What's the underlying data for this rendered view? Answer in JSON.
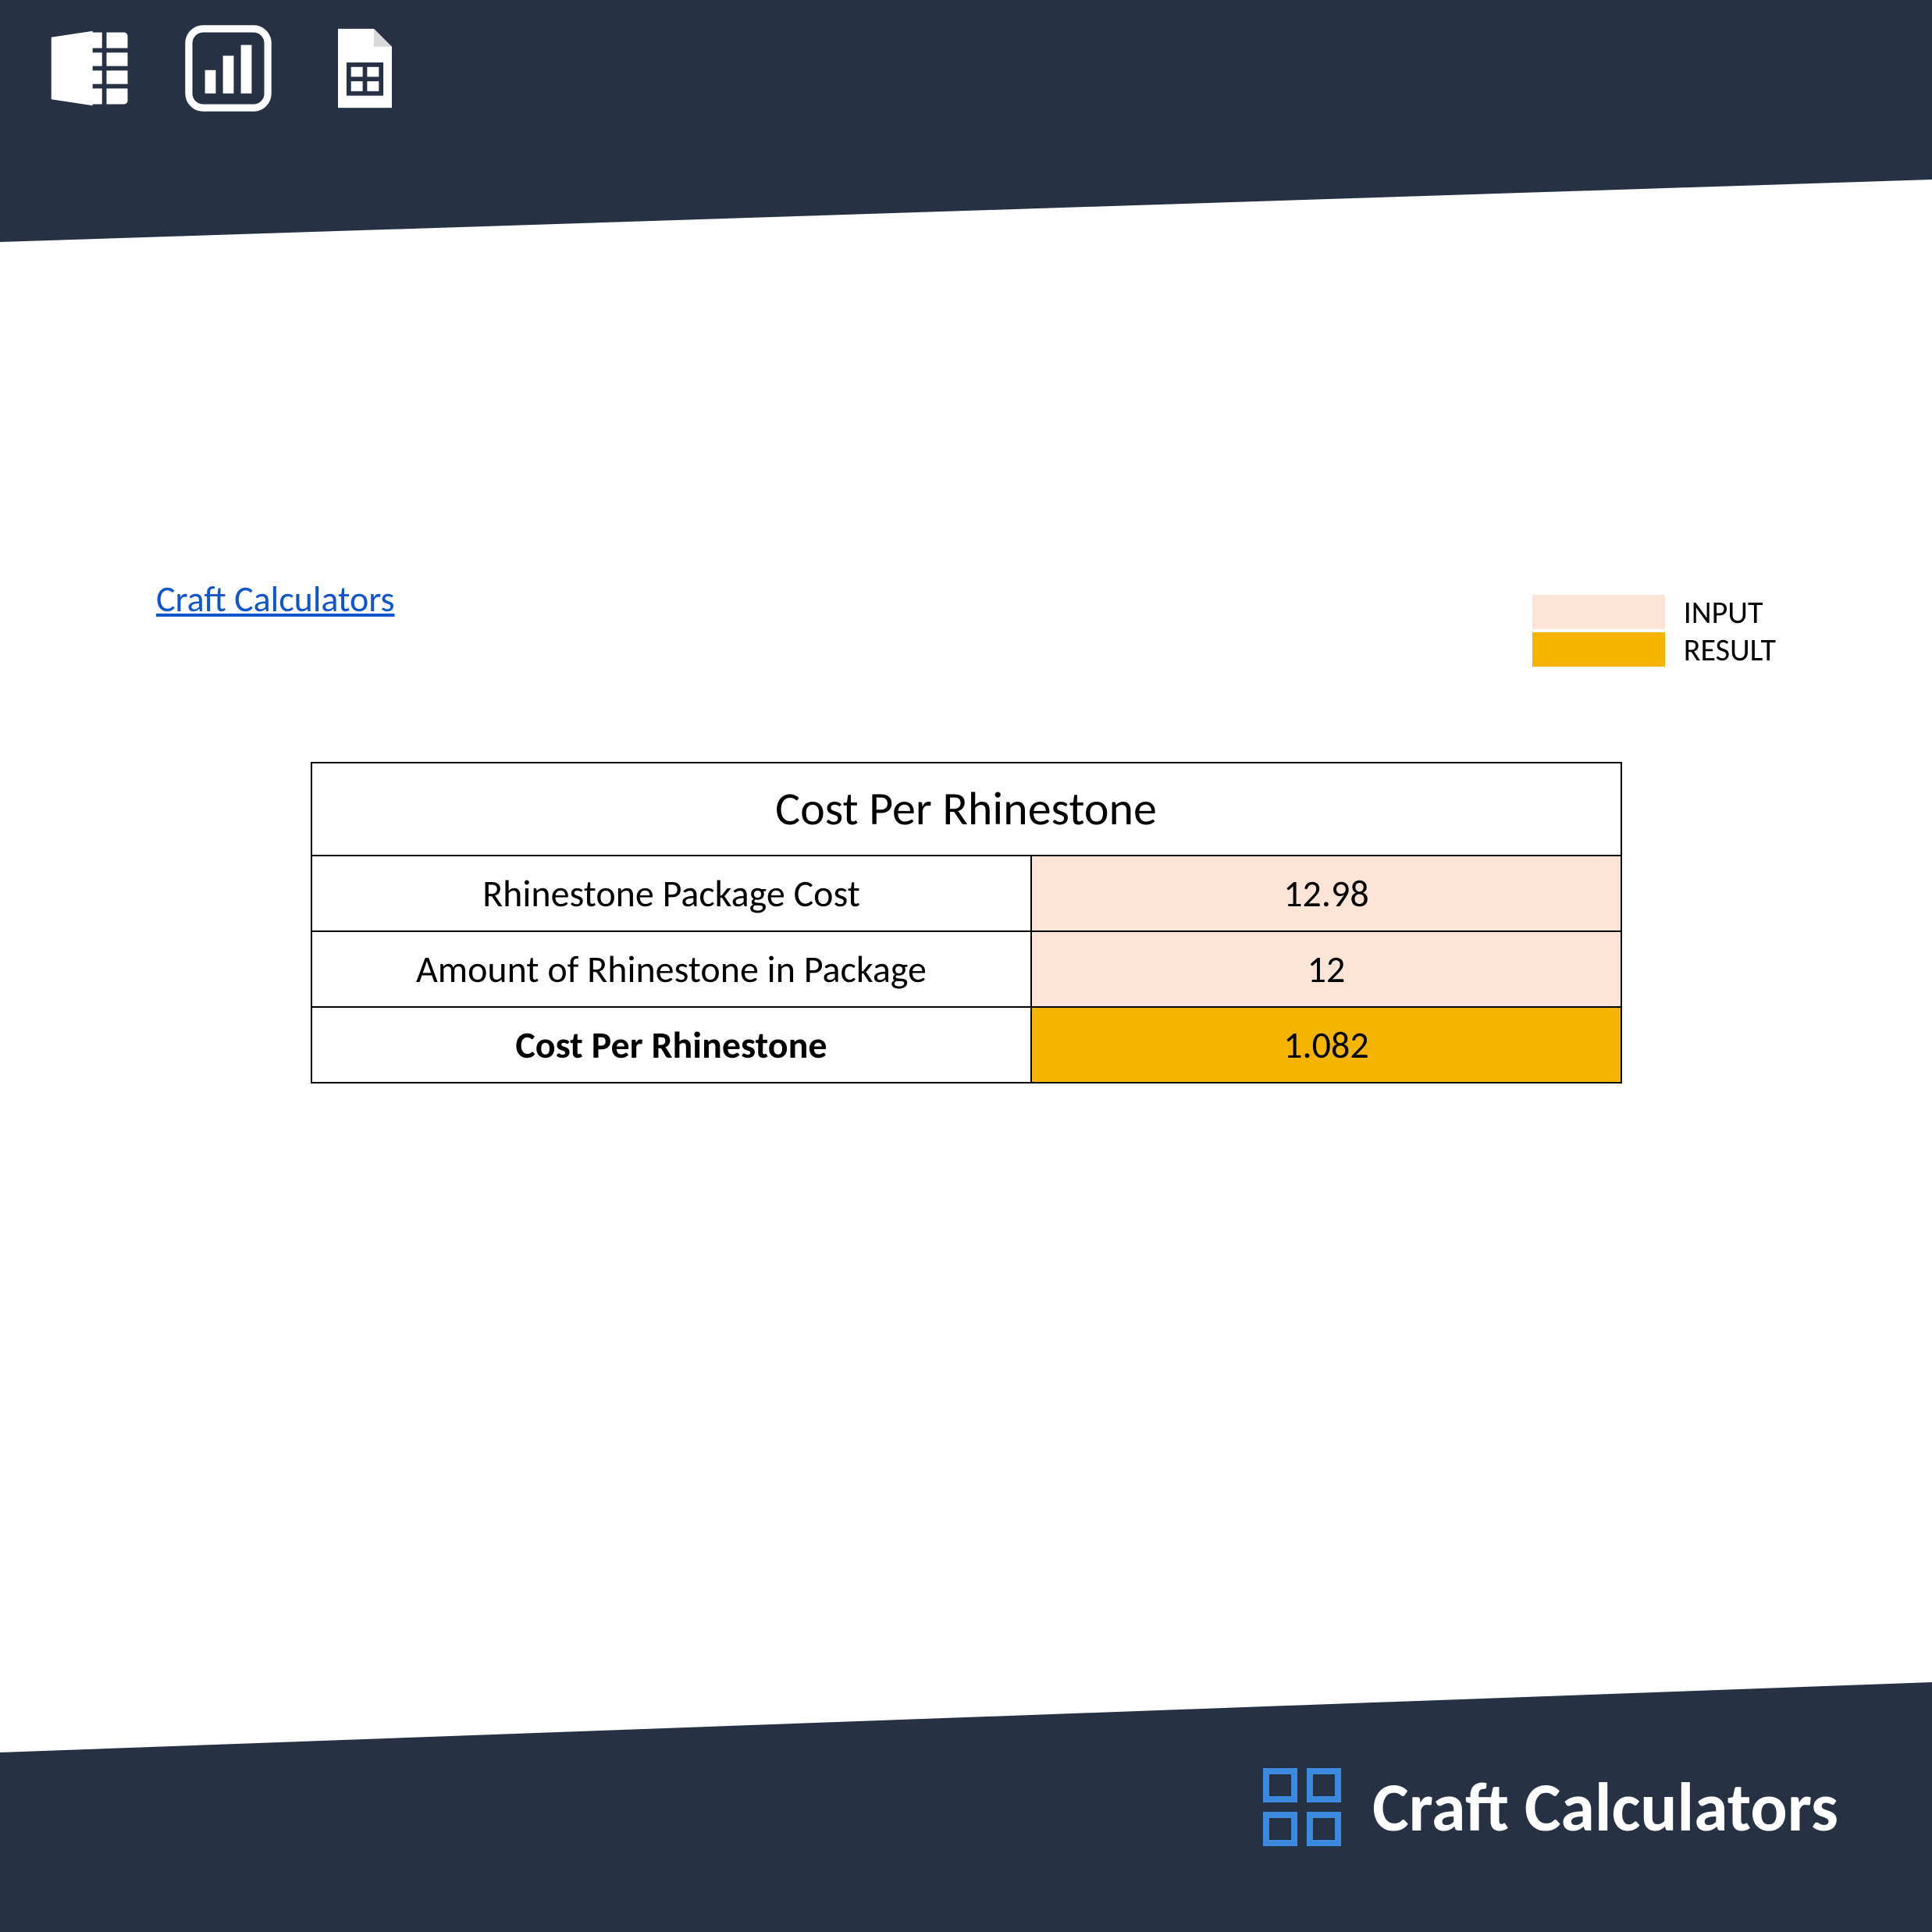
{
  "colors": {
    "banner": "#263244",
    "input_bg": "#fce5d6",
    "result_bg": "#f4b400",
    "link": "#1155cc",
    "logo_blue": "#3a8be0"
  },
  "link": {
    "label": "Craft Calculators"
  },
  "legend": {
    "input_label": "INPUT",
    "result_label": "RESULT"
  },
  "table": {
    "title": "Cost Per Rhinestone",
    "rows": [
      {
        "label": "Rhinestone Package Cost",
        "value": "12.98",
        "type": "input"
      },
      {
        "label": "Amount of Rhinestone in Package",
        "value": "12",
        "type": "input"
      },
      {
        "label": "Cost Per Rhinestone",
        "value": "1.082",
        "type": "result"
      }
    ]
  },
  "footer": {
    "brand": "Craft Calculators"
  },
  "icons": {
    "excel": "excel-icon",
    "chart": "chart-icon",
    "sheets": "sheets-icon"
  }
}
